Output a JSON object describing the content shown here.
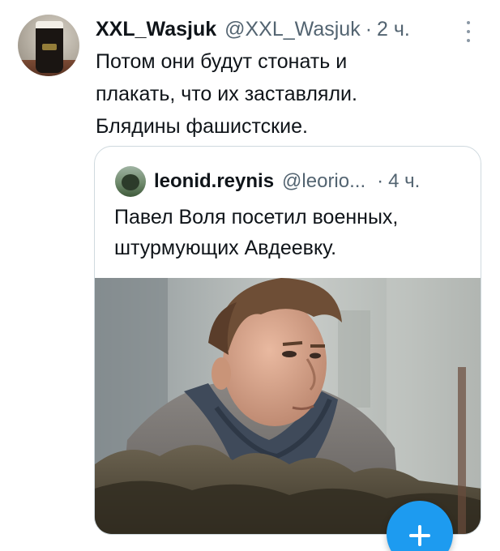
{
  "tweet": {
    "author": {
      "display_name": "XXL_Wasjuk",
      "handle": "@XXL_Wasjuk",
      "separator": "·",
      "time": "2 ч."
    },
    "text_lines": [
      "Потом они будут стонать и",
      "плакать, что их заставляли.",
      "Блядины фашистские."
    ],
    "more_icon": "vertical-ellipsis-icon"
  },
  "quote": {
    "author": {
      "display_name": "leonid.reynis",
      "handle": "@leorio...",
      "separator": "·",
      "time": "4 ч."
    },
    "text_lines": [
      "Павел Воля посетил военных,",
      "штурмующих Авдеевку."
    ]
  },
  "compose_button": {
    "icon": "plus-icon",
    "color": "#1d9bf0"
  },
  "colors": {
    "text": "#0f1419",
    "secondary": "#536471",
    "border": "#cfd9de",
    "accent": "#1d9bf0"
  }
}
